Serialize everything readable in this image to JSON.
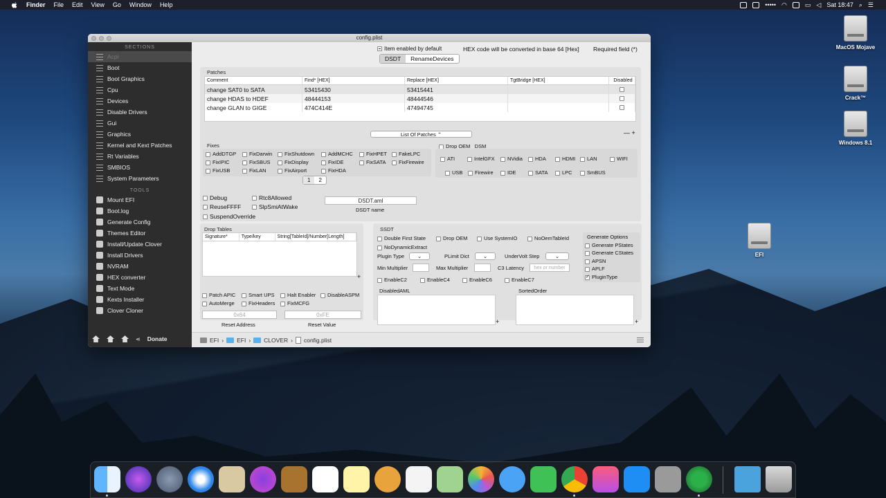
{
  "menubar": {
    "app": "Finder",
    "items": [
      "File",
      "Edit",
      "View",
      "Go",
      "Window",
      "Help"
    ],
    "clock": "Sat 18:47"
  },
  "desktop": {
    "icons": [
      "MacOS Mojave",
      "Crack™",
      "Windows 8.1",
      "EFI"
    ]
  },
  "window": {
    "title": "config.plist"
  },
  "sidebar": {
    "sections_head": "SECTIONS",
    "sections": [
      "Acpi",
      "Boot",
      "Boot Graphics",
      "Cpu",
      "Devices",
      "Disable Drivers",
      "Gui",
      "Graphics",
      "Kernel and Kext Patches",
      "Rt Variables",
      "SMBIOS",
      "System Parameters"
    ],
    "tools_head": "TOOLS",
    "tools": [
      "Mount EFI",
      "Boot.log",
      "Generate Config",
      "Themes Editor",
      "Install/Update Clover",
      "Install Drivers",
      "NVRAM",
      "HEX converter",
      "Text Mode",
      "Kexts Installer",
      "Clover Cloner"
    ],
    "donate": "Donate"
  },
  "top": {
    "enabled_default": "Item enabled by default",
    "hex_note": "HEX code will be converted in base 64 [Hex]",
    "required": "Required field (*)",
    "tabs": [
      "DSDT",
      "RenameDevices"
    ]
  },
  "patches": {
    "label": "Patches",
    "headers": [
      "Comment",
      "Find* [HEX]",
      "Replace [HEX]",
      "TgtBridge [HEX]",
      "Disabled"
    ],
    "rows": [
      [
        "change SAT0 to SATA",
        "53415430",
        "53415441",
        ""
      ],
      [
        "change HDAS to HDEF",
        "48444153",
        "48444546",
        ""
      ],
      [
        "change GLAN to GIGE",
        "474C414E",
        "47494745",
        ""
      ]
    ],
    "list_button": "List Of Patches"
  },
  "fixes": {
    "label": "Fixes",
    "items": [
      [
        "AddDTGP",
        "FixDarwin",
        "FixShutdown",
        "AddMCHC",
        "FixHPET",
        "FakeLPC"
      ],
      [
        "FixIPIC",
        "FixSBUS",
        "FixDisplay",
        "FixIDE",
        "FixSATA",
        "FixFirewire"
      ],
      [
        "FixUSB",
        "FixLAN",
        "FixAirport",
        "FixHDA",
        "",
        ""
      ]
    ],
    "pages": [
      "1",
      "2"
    ]
  },
  "dropoem": {
    "label": "Drop OEM _DSM",
    "row1": [
      "ATI",
      "IntelGFX",
      "NVidia",
      "HDA",
      "HDMI",
      "LAN",
      "WIFI"
    ],
    "row2": [
      "USB",
      "Firewire",
      "IDE",
      "SATA",
      "LPC",
      "SmBUS"
    ]
  },
  "misc": {
    "debug": "Debug",
    "rtc": "Rtc8Allowed",
    "reuse": "ReuseFFFF",
    "slp": "SlpSmiAtWake",
    "suspend": "SuspendOverride",
    "dsdt_value": "DSDT.aml",
    "dsdt_label": "DSDT name"
  },
  "droptables": {
    "label": "Drop Tables",
    "headers": [
      "Signature*",
      "Type/key",
      "String[TableId]/Number[Length]"
    ]
  },
  "lower": {
    "patch_apic": "Patch APIC",
    "smart_ups": "Smart UPS",
    "halt": "Halt Enabler",
    "disable_aspm": "DisableASPM",
    "automerge": "AutoMerge",
    "fixheaders": "FixHeaders",
    "fixmcfg": "FixMCFG",
    "addr_ph": "0x64",
    "value_ph": "0xFE",
    "reset_addr": "Reset Address",
    "reset_value": "Reset Value"
  },
  "ssdt": {
    "label": "SSDT",
    "double": "Double First State",
    "drop_oem": "Drop OEM",
    "use_sysio": "Use SystemIO",
    "nooem": "NoOemTableId",
    "nodyn": "NoDynamicExtract",
    "plugin_type": "Plugin Type",
    "plimit": "PLimit Dict",
    "undervolt": "UnderVolt Step",
    "min_mult": "Min Multiplier",
    "max_mult": "Max Multiplier",
    "c3": "C3 Latency",
    "c3_ph": "hex or number",
    "c2": "EnableC2",
    "c4": "EnableC4",
    "c6": "EnableC6",
    "c7": "EnableC7",
    "gen_head": "Generate Options",
    "gen": [
      "Generate PStates",
      "Generate CStates",
      "APSN",
      "APLF",
      "PluginType"
    ],
    "disabledaml": "DisabledAML",
    "sortedorder": "SortedOrder"
  },
  "path": [
    "EFI",
    "EFI",
    "CLOVER",
    "config.plist"
  ]
}
